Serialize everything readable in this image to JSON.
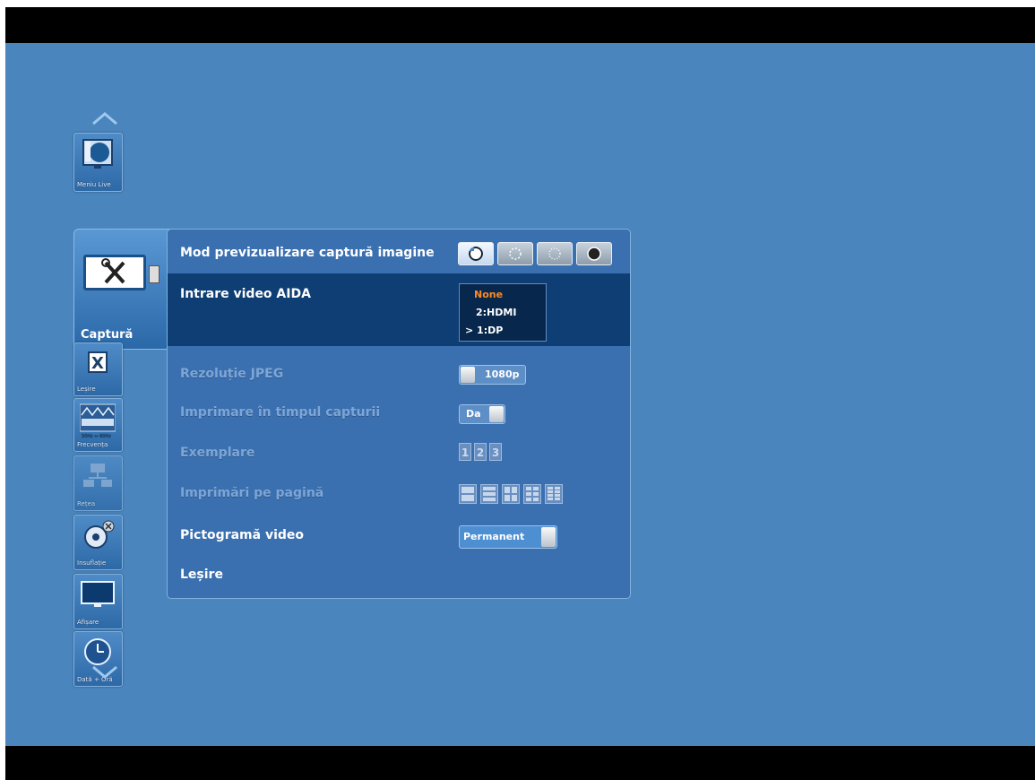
{
  "sidebar": {
    "items": [
      {
        "name": "monitor",
        "label": "Meniu Live"
      },
      {
        "name": "capture",
        "label": "Captură"
      },
      {
        "name": "exit",
        "label": "Leșire"
      },
      {
        "name": "frequency",
        "label": "Frecvența",
        "sub": "50Hz ↔ 60Hz"
      },
      {
        "name": "network",
        "label": "Rețea"
      },
      {
        "name": "insufflation",
        "label": "Insuflație"
      },
      {
        "name": "display",
        "label": "Afișare"
      },
      {
        "name": "datetime",
        "label": "Dată + Oră"
      }
    ]
  },
  "panel": {
    "preview_mode_label": "Mod previzualizare captură imagine",
    "aida_label": "Intrare video AIDA",
    "aida_options": [
      "None",
      "2:HDMI",
      "> 1:DP"
    ],
    "jpeg_label": "Rezoluție JPEG",
    "jpeg_value": "1080p",
    "print_label": "Imprimare în timpul capturii",
    "print_value": "Da",
    "copies_label": "Exemplare",
    "copies_options": [
      "1",
      "2",
      "3"
    ],
    "pages_label": "Imprimări pe pagină",
    "video_icon_label": "Pictogramă video",
    "video_icon_value": "Permanent",
    "exit_label": "Leșire"
  }
}
